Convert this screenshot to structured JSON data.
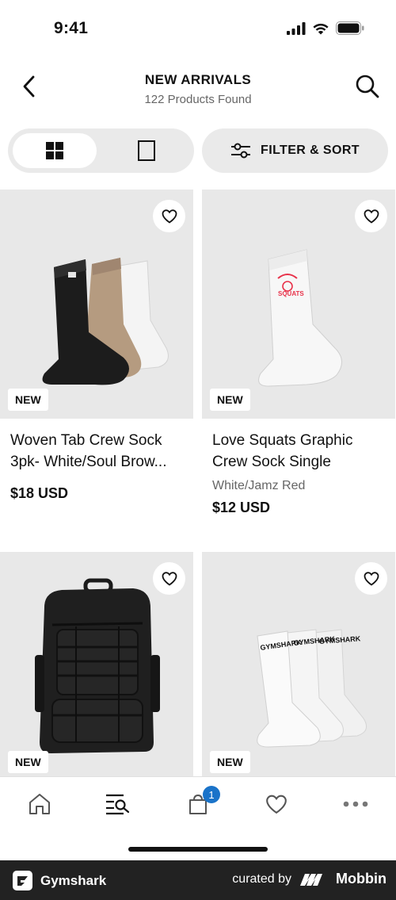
{
  "status_bar": {
    "time": "9:41"
  },
  "header": {
    "title": "NEW ARRIVALS",
    "subtitle": "122 Products Found"
  },
  "toolbar": {
    "filter_label": "FILTER & SORT",
    "active_view": "grid"
  },
  "products": [
    {
      "name": "Woven Tab Crew Sock 3pk- White/Soul Brow...",
      "color": "",
      "price": "$18 USD",
      "badge": "NEW"
    },
    {
      "name": "Love Squats Graphic Crew Sock Single",
      "color": "White/Jamz Red",
      "price": "$12 USD",
      "badge": "NEW"
    },
    {
      "name": "",
      "color": "",
      "price": "",
      "badge": "NEW"
    },
    {
      "name": "",
      "color": "",
      "price": "",
      "badge": "NEW"
    }
  ],
  "sock_graphic_text": "SQUATS",
  "sock_brand_text": "GYMSHARK",
  "bottom_nav": {
    "items": [
      "home-icon",
      "shop-search-icon",
      "bag-icon",
      "heart-icon",
      "more-icon"
    ],
    "active": "shop-search-icon",
    "cart_count": "1"
  },
  "footer": {
    "brand": "Gymshark",
    "curated_by": "curated by",
    "platform": "Mobbin"
  },
  "colors": {
    "accent_badge": "#1a73c9",
    "card_bg": "#e8e8e8",
    "footer_bg": "#222222"
  }
}
